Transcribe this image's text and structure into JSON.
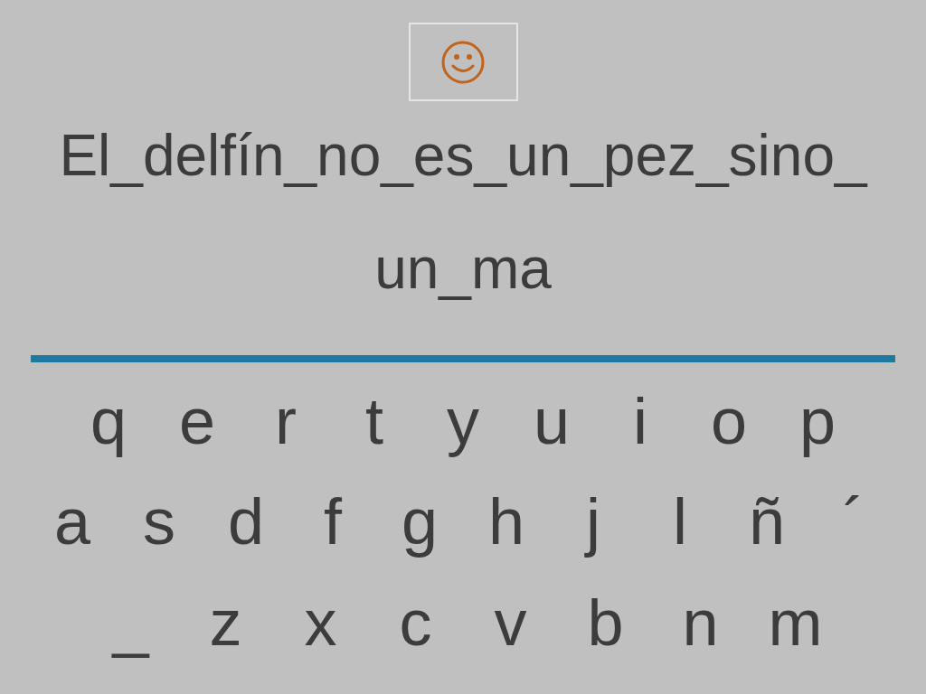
{
  "sentence_lines": [
    "El_delfín_no_es_un_pez_sino_",
    "un_ma"
  ],
  "keyboard": {
    "rows": [
      [
        "q",
        "e",
        "r",
        "t",
        "y",
        "u",
        "i",
        "o",
        "p"
      ],
      [
        "a",
        "s",
        "d",
        "f",
        "g",
        "h",
        "j",
        "l",
        "ñ",
        "´"
      ],
      [
        "_",
        "z",
        "x",
        "c",
        "v",
        "b",
        "n",
        "m"
      ]
    ]
  }
}
